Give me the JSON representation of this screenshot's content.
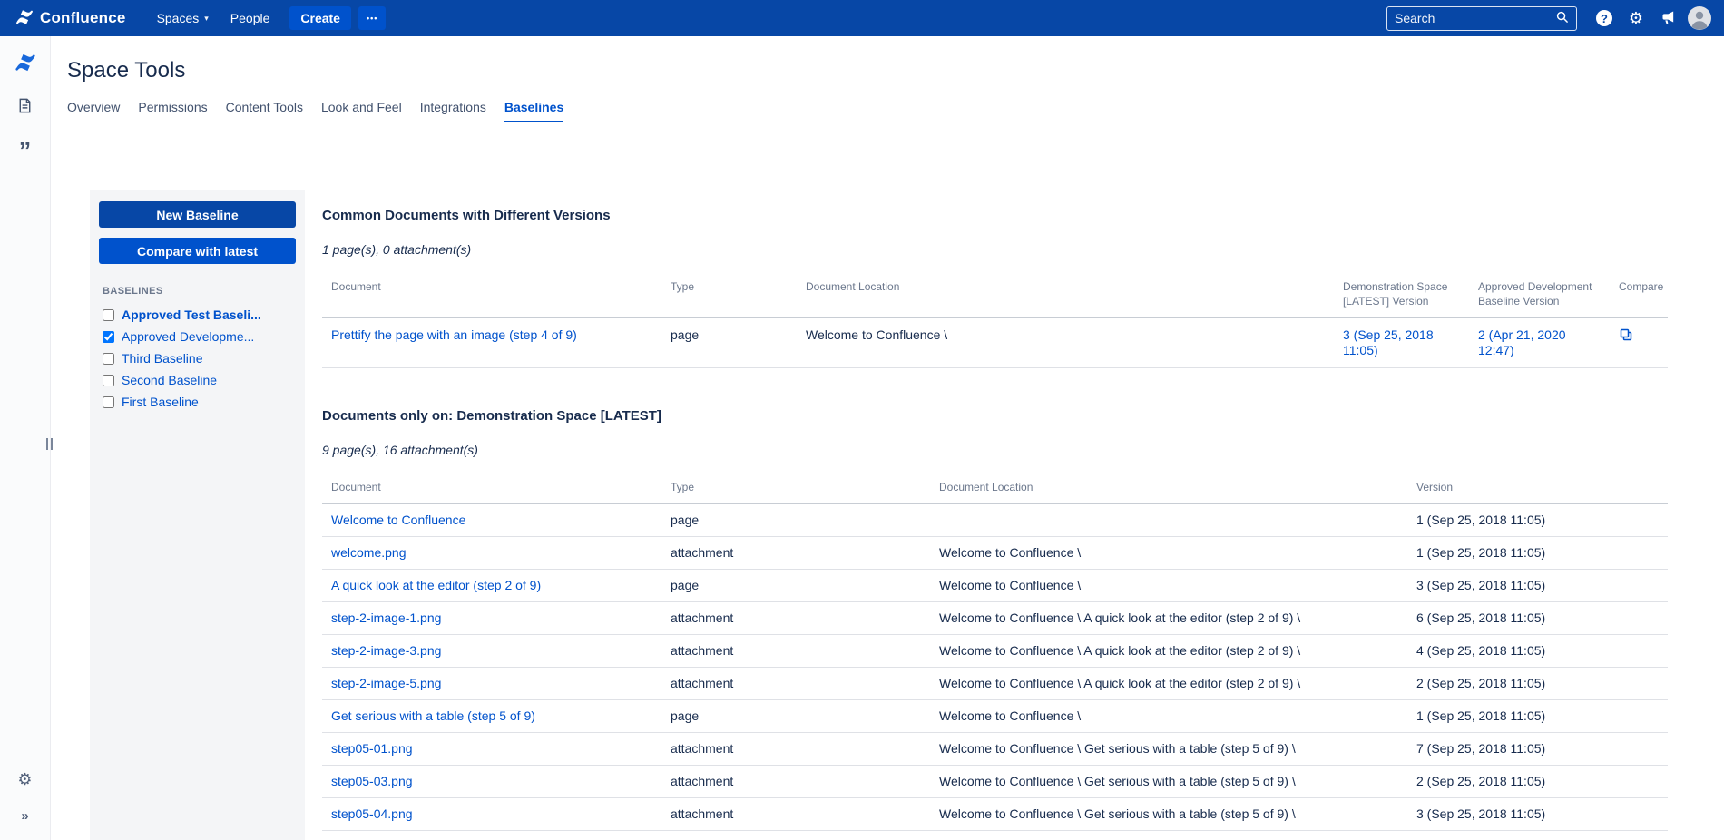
{
  "topbar": {
    "brand": "Confluence",
    "spaces_label": "Spaces",
    "people_label": "People",
    "create_label": "Create",
    "more_label": "•••",
    "search_placeholder": "Search"
  },
  "page": {
    "title": "Space Tools",
    "tabs": [
      {
        "label": "Overview",
        "active": false
      },
      {
        "label": "Permissions",
        "active": false
      },
      {
        "label": "Content Tools",
        "active": false
      },
      {
        "label": "Look and Feel",
        "active": false
      },
      {
        "label": "Integrations",
        "active": false
      },
      {
        "label": "Baselines",
        "active": true
      }
    ]
  },
  "baselines_panel": {
    "new_baseline_label": "New Baseline",
    "compare_label": "Compare with latest",
    "list_heading": "BASELINES",
    "items": [
      {
        "label": "Approved Test Baseli...",
        "checked": false,
        "bold": true
      },
      {
        "label": "Approved Developme...",
        "checked": true,
        "bold": false
      },
      {
        "label": "Third Baseline",
        "checked": false,
        "bold": false
      },
      {
        "label": "Second Baseline",
        "checked": false,
        "bold": false
      },
      {
        "label": "First Baseline",
        "checked": false,
        "bold": false
      }
    ]
  },
  "common_section": {
    "heading": "Common Documents with Different Versions",
    "summary": "1 page(s), 0 attachment(s)",
    "columns": {
      "document": "Document",
      "type": "Type",
      "location": "Document Location",
      "latest": "Demonstration Space [LATEST] Version",
      "baseline": "Approved Development Baseline Version",
      "compare": "Compare"
    },
    "rows": [
      {
        "document": "Prettify the page with an image (step 4 of 9)",
        "type": "page",
        "location": "Welcome to Confluence \\",
        "latest_version": "3 (Sep 25, 2018 11:05)",
        "baseline_version": "2 (Apr 21, 2020 12:47)"
      }
    ]
  },
  "only_section": {
    "heading": "Documents only on: Demonstration Space [LATEST]",
    "summary": "9 page(s), 16 attachment(s)",
    "columns": {
      "document": "Document",
      "type": "Type",
      "location": "Document Location",
      "version": "Version"
    },
    "rows": [
      {
        "document": "Welcome to Confluence",
        "type": "page",
        "location": "",
        "version": "1 (Sep 25, 2018 11:05)"
      },
      {
        "document": "welcome.png",
        "type": "attachment",
        "location": "Welcome to Confluence \\",
        "version": "1 (Sep 25, 2018 11:05)"
      },
      {
        "document": "A quick look at the editor (step 2 of 9)",
        "type": "page",
        "location": "Welcome to Confluence \\",
        "version": "3 (Sep 25, 2018 11:05)"
      },
      {
        "document": "step-2-image-1.png",
        "type": "attachment",
        "location": "Welcome to Confluence \\ A quick look at the editor (step 2 of 9) \\",
        "version": "6 (Sep 25, 2018 11:05)"
      },
      {
        "document": "step-2-image-3.png",
        "type": "attachment",
        "location": "Welcome to Confluence \\ A quick look at the editor (step 2 of 9) \\",
        "version": "4 (Sep 25, 2018 11:05)"
      },
      {
        "document": "step-2-image-5.png",
        "type": "attachment",
        "location": "Welcome to Confluence \\ A quick look at the editor (step 2 of 9) \\",
        "version": "2 (Sep 25, 2018 11:05)"
      },
      {
        "document": "Get serious with a table (step 5 of 9)",
        "type": "page",
        "location": "Welcome to Confluence \\",
        "version": "1 (Sep 25, 2018 11:05)"
      },
      {
        "document": "step05-01.png",
        "type": "attachment",
        "location": "Welcome to Confluence \\ Get serious with a table (step 5 of 9) \\",
        "version": "7 (Sep 25, 2018 11:05)"
      },
      {
        "document": "step05-03.png",
        "type": "attachment",
        "location": "Welcome to Confluence \\ Get serious with a table (step 5 of 9) \\",
        "version": "2 (Sep 25, 2018 11:05)"
      },
      {
        "document": "step05-04.png",
        "type": "attachment",
        "location": "Welcome to Confluence \\ Get serious with a table (step 5 of 9) \\",
        "version": "3 (Sep 25, 2018 11:05)"
      }
    ]
  },
  "colors": {
    "topbar": "#0747A6",
    "accent": "#0052CC",
    "link": "#0052CC",
    "panel_background": "#F4F5F7",
    "dark_button": "#0747A6"
  }
}
